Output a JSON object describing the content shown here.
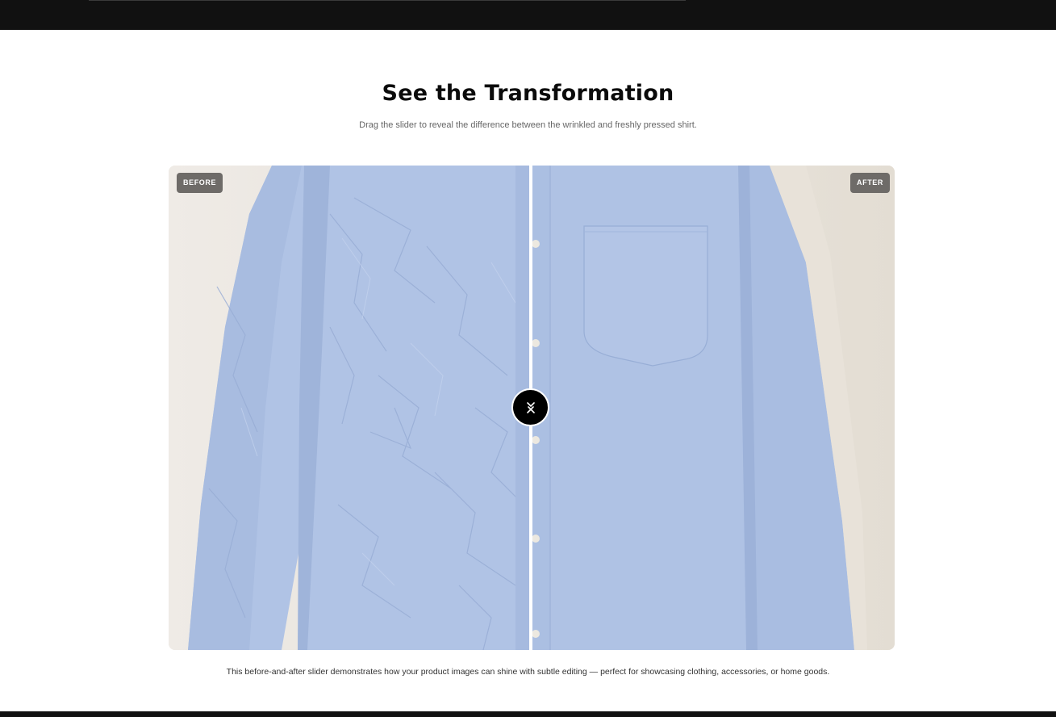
{
  "section": {
    "title": "See the Transformation",
    "subtitle": "Drag the slider to reveal the difference between the wrinkled and freshly pressed shirt."
  },
  "slider": {
    "before_label": "BEFORE",
    "after_label": "AFTER",
    "position": 0.5,
    "handle_icon": "drag-arrows-icon"
  },
  "caption": "This before-and-after slider demonstrates how your product images can shine with subtle editing — perfect for showcasing clothing, accessories, or home goods.",
  "colors": {
    "shirt": "#aec1e3",
    "background": "#ece7e0",
    "handle": "#000000",
    "badge": "#6e6b68"
  }
}
